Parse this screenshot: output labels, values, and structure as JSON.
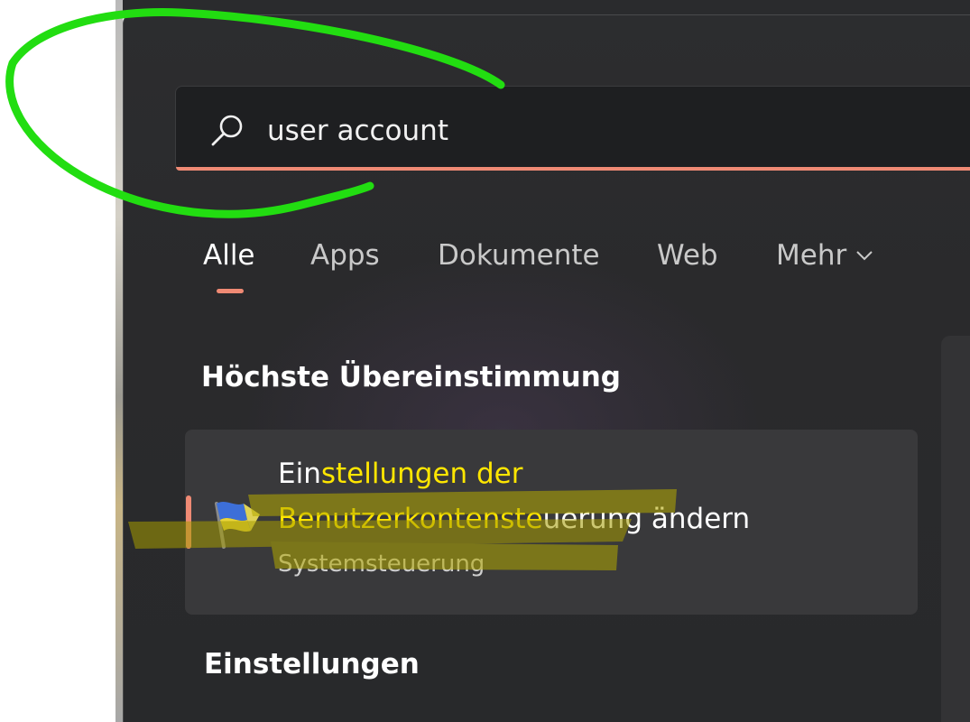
{
  "search": {
    "value": "user account",
    "icon": "search-icon"
  },
  "tabs": [
    {
      "label": "Alle",
      "active": true
    },
    {
      "label": "Apps",
      "active": false
    },
    {
      "label": "Dokumente",
      "active": false
    },
    {
      "label": "Web",
      "active": false
    },
    {
      "label": "Mehr",
      "active": false,
      "icon": "chevron-down-icon"
    }
  ],
  "best_match": {
    "heading": "Höchste Übereinstimmung",
    "result": {
      "line1_plain": "Ein",
      "line1_highlight": "stellungen der",
      "line2_highlight": "Benutzerkontenste",
      "line2_plain": "uerung ändern",
      "subtitle": "Systemsteuerung",
      "icon": "uac-flag-icon"
    }
  },
  "settings_section": {
    "heading": "Einstellungen"
  },
  "colors": {
    "accent": "#ef8a74",
    "annotation_green": "#22dd11",
    "highlighter_yellow": "#ffe600",
    "panel_background": "#2b2c2e"
  }
}
